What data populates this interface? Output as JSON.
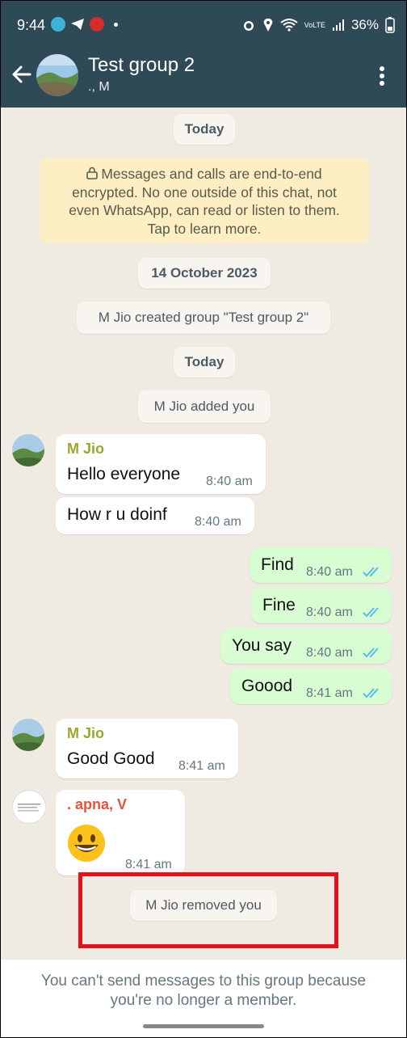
{
  "status_bar": {
    "time": "9:44",
    "battery": "36%",
    "network": "VoLTE",
    "colors": {
      "bar": "#2f4a57"
    }
  },
  "header": {
    "title": "Test group 2",
    "subtitle": "., M"
  },
  "chat": {
    "date_today_1": "Today",
    "encryption_notice": {
      "line1": "Messages and calls are end-to-end",
      "line2": "encrypted. No one outside of this chat, not",
      "line3": "even WhatsApp, can read or listen to them.",
      "line4": "Tap to learn more."
    },
    "date_created": "14 October 2023",
    "system_created": "M Jio created group \"Test group 2\"",
    "date_today_2": "Today",
    "system_added": "M Jio added you",
    "messages": [
      {
        "sender": "M Jio",
        "text": "Hello everyone",
        "time": "8:40 am"
      },
      {
        "text": "How r u doinf",
        "time": "8:40 am"
      },
      {
        "text": "Find",
        "time": "8:40 am"
      },
      {
        "text": "Fine",
        "time": "8:40 am"
      },
      {
        "text": "You say",
        "time": "8:40 am"
      },
      {
        "text": "Goood",
        "time": "8:41 am"
      },
      {
        "sender": "M Jio",
        "text": "Good Good",
        "time": "8:41 am"
      },
      {
        "sender": ". apna, V",
        "text": "😀",
        "time": "8:41 am"
      }
    ],
    "system_removed": "M Jio removed you",
    "colors": {
      "sender_mjio": "#9aa62c",
      "sender_apna": "#e5533c",
      "ticks": "#53bdeb",
      "highlight": "#e8111b"
    }
  },
  "footer": {
    "line1": "You can't send messages to this group because",
    "line2": "you're no longer a member."
  },
  "icons": [
    "back-arrow-icon",
    "more-options-icon",
    "lock-icon",
    "double-tick-icon",
    "alarm-icon",
    "location-icon",
    "wifi-icon",
    "signal-icon"
  ]
}
